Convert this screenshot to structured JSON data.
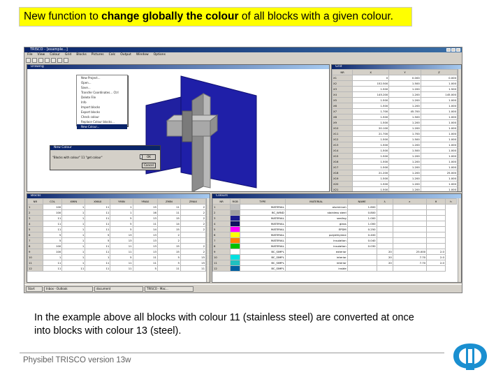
{
  "slide": {
    "title_part1": "New function to ",
    "title_bold1": "change globally the colour",
    "title_part2": " of all blocks with a given colour.",
    "caption_line1": "In the example above all blocks with colour 11 (stainless steel) are converted at once",
    "caption_line2": "into blocks with colour 13 (steel).",
    "footer": "Physibel TRISCO version 13w"
  },
  "app": {
    "title": "TRISCO - [example...]",
    "menu": [
      "File",
      "View",
      "Colour",
      "Grid",
      "Blocks",
      "Pictures",
      "Calc",
      "Output",
      "Window",
      "Options"
    ],
    "drawing_window_title": "Drawing",
    "grid_window_title": "Grid",
    "blocks_window_title": "Blocks",
    "colours_window_title": "Colours"
  },
  "file_menu": {
    "items": [
      "New Project...",
      "Open...",
      "Save...",
      "Transfer Coordinates... Ctrl",
      "Delete File",
      "Info",
      "Import blocks",
      "Export blocks",
      "Check colour",
      "Replace Colour blocks...",
      "New Colour..."
    ],
    "selected_index": 10
  },
  "dialog": {
    "title": "New Colour",
    "label": "\"Blocks with colour\" 11 \"get colour\"",
    "value": "13",
    "ok": "OK",
    "cancel": "Cancel"
  },
  "grid": {
    "headers": [
      "NR",
      "X",
      "Y",
      "Z"
    ],
    "rows": [
      [
        "X1",
        "0",
        "0.000",
        "0.000"
      ],
      [
        "X2",
        "152.500",
        "1.500",
        "1.000"
      ],
      [
        "X3",
        "1.500",
        "1.200",
        "1.500"
      ],
      [
        "X4",
        "145.200",
        "1.200",
        "145.000"
      ],
      [
        "X5",
        "1.500",
        "1.200",
        "1.000"
      ],
      [
        "X6",
        "1.500",
        "1.200",
        "1.000"
      ],
      [
        "X7",
        "1.700",
        "45.700",
        "1.000"
      ],
      [
        "X8",
        "1.500",
        "1.500",
        "1.000"
      ],
      [
        "X9",
        "1.500",
        "1.200",
        "1.000"
      ],
      [
        "X10",
        "20.100",
        "1.200",
        "1.000"
      ],
      [
        "X11",
        "21.700",
        "1.700",
        "1.000"
      ],
      [
        "X12",
        "1.500",
        "1.500",
        "1.000"
      ],
      [
        "X13",
        "1.500",
        "1.200",
        "1.000"
      ],
      [
        "X14",
        "1.500",
        "1.500",
        "1.000"
      ],
      [
        "X15",
        "1.500",
        "1.200",
        "1.000"
      ],
      [
        "X16",
        "1.500",
        "1.200",
        "1.000"
      ],
      [
        "X17",
        "1.500",
        "1.200",
        "1.000"
      ],
      [
        "X18",
        "21.200",
        "1.200",
        "25.000"
      ],
      [
        "X19",
        "1.500",
        "1.200",
        "1.000"
      ],
      [
        "X20",
        "1.500",
        "1.200",
        "1.000"
      ],
      [
        "X21",
        "1.500",
        "1.200",
        "1.000"
      ],
      [
        "X22",
        "1.500",
        "1.200",
        "1.000"
      ],
      [
        "X23",
        "20.400",
        "1.200",
        "1.000"
      ]
    ]
  },
  "blocks": {
    "headers": [
      "NR",
      "COL",
      "XMIN",
      "XMAX",
      "YMIN",
      "YMAX",
      "ZMIN",
      "ZMAX"
    ],
    "rows": [
      [
        "1",
        "100",
        "1",
        "11",
        "1",
        "15",
        "11",
        "2"
      ],
      [
        "2",
        "100",
        "1",
        "11",
        "1",
        "16",
        "11",
        "2"
      ],
      [
        "3",
        "11",
        "1",
        "11",
        "5",
        "13",
        "15",
        "2"
      ],
      [
        "4",
        "11",
        "1",
        "11",
        "5",
        "11",
        "14",
        "2"
      ],
      [
        "5",
        "11",
        "1",
        "11",
        "5",
        "14",
        "15",
        "2"
      ],
      [
        "6",
        "5",
        "1",
        "5",
        "13",
        "13",
        "2",
        ""
      ],
      [
        "7",
        "5",
        "1",
        "5",
        "13",
        "13",
        "2",
        ""
      ],
      [
        "8",
        "100",
        "1",
        "11",
        "11",
        "13",
        "15",
        "2"
      ],
      [
        "9",
        "100",
        "1",
        "11",
        "11",
        "13",
        "15",
        "2"
      ],
      [
        "10",
        "1",
        "1",
        "1",
        "5",
        "11",
        "5",
        "15"
      ],
      [
        "11",
        "11",
        "1",
        "11",
        "11",
        "11",
        "5",
        "15"
      ],
      [
        "12",
        "11",
        "11",
        "11",
        "11",
        "5",
        "11",
        "11"
      ]
    ]
  },
  "colours": {
    "headers": [
      "NR",
      "RGB",
      "TYPE",
      "MATERIAL",
      "NAME",
      "λ",
      "ε",
      "θ",
      "h"
    ],
    "rows": [
      [
        "1",
        "#c0c0c0",
        "MATERIAL",
        "aluminium",
        "1.600",
        "",
        "",
        ""
      ],
      [
        "2",
        "#a0a0a0",
        "BC_WIND",
        "stainless steel",
        "0.800",
        "",
        "",
        ""
      ],
      [
        "3",
        "#1a1a8c",
        "MATERIAL",
        "sealing",
        "1.000",
        "",
        "",
        ""
      ],
      [
        "4",
        "#101060",
        "MATERIAL",
        "glass",
        "1.000",
        "",
        "",
        ""
      ],
      [
        "5",
        "#ff00ff",
        "MATERIAL",
        "EPDM",
        "0.250",
        "",
        "",
        ""
      ],
      [
        "6",
        "#ffff00",
        "MATERIAL",
        "polyethylene",
        "0.400",
        "",
        "",
        ""
      ],
      [
        "7",
        "#ff8000",
        "MATERIAL",
        "insulation",
        "0.040",
        "",
        "",
        ""
      ],
      [
        "8",
        "#00c000",
        "MATERIAL",
        "insulation",
        "0.030",
        "",
        "",
        ""
      ],
      [
        "9",
        "#ffffff",
        "BC_SIMPL",
        "exterior",
        "",
        "20",
        "25.000",
        "2.0"
      ],
      [
        "10",
        "#00e0e0",
        "BC_SIMPL",
        "interior",
        "",
        "20",
        "7.70",
        "2.0"
      ],
      [
        "11",
        "#20c0c0",
        "BC_SIMPL",
        "interior",
        "",
        "20",
        "7.70",
        "2.0"
      ],
      [
        "12",
        "#0060a0",
        "BC_SIMPL",
        "inside",
        "",
        "",
        "",
        ""
      ]
    ]
  },
  "taskbar": [
    "Start",
    "Inbox - Outlook",
    "document",
    "TRISCO - Mac..."
  ],
  "colors": {
    "title_highlight": "#ffff00",
    "panel_blue": "#1f1fa8",
    "frame_grey": "#9a9a9a"
  }
}
